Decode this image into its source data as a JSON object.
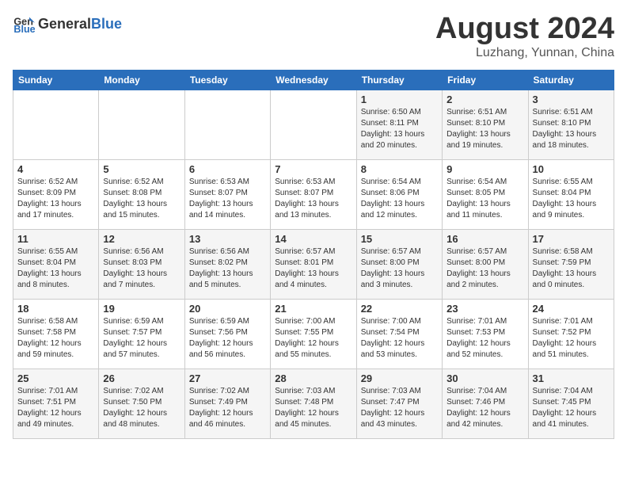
{
  "header": {
    "logo_general": "General",
    "logo_blue": "Blue",
    "month_year": "August 2024",
    "location": "Luzhang, Yunnan, China"
  },
  "weekdays": [
    "Sunday",
    "Monday",
    "Tuesday",
    "Wednesday",
    "Thursday",
    "Friday",
    "Saturday"
  ],
  "weeks": [
    [
      {
        "day": "",
        "info": ""
      },
      {
        "day": "",
        "info": ""
      },
      {
        "day": "",
        "info": ""
      },
      {
        "day": "",
        "info": ""
      },
      {
        "day": "1",
        "info": "Sunrise: 6:50 AM\nSunset: 8:11 PM\nDaylight: 13 hours\nand 20 minutes."
      },
      {
        "day": "2",
        "info": "Sunrise: 6:51 AM\nSunset: 8:10 PM\nDaylight: 13 hours\nand 19 minutes."
      },
      {
        "day": "3",
        "info": "Sunrise: 6:51 AM\nSunset: 8:10 PM\nDaylight: 13 hours\nand 18 minutes."
      }
    ],
    [
      {
        "day": "4",
        "info": "Sunrise: 6:52 AM\nSunset: 8:09 PM\nDaylight: 13 hours\nand 17 minutes."
      },
      {
        "day": "5",
        "info": "Sunrise: 6:52 AM\nSunset: 8:08 PM\nDaylight: 13 hours\nand 15 minutes."
      },
      {
        "day": "6",
        "info": "Sunrise: 6:53 AM\nSunset: 8:07 PM\nDaylight: 13 hours\nand 14 minutes."
      },
      {
        "day": "7",
        "info": "Sunrise: 6:53 AM\nSunset: 8:07 PM\nDaylight: 13 hours\nand 13 minutes."
      },
      {
        "day": "8",
        "info": "Sunrise: 6:54 AM\nSunset: 8:06 PM\nDaylight: 13 hours\nand 12 minutes."
      },
      {
        "day": "9",
        "info": "Sunrise: 6:54 AM\nSunset: 8:05 PM\nDaylight: 13 hours\nand 11 minutes."
      },
      {
        "day": "10",
        "info": "Sunrise: 6:55 AM\nSunset: 8:04 PM\nDaylight: 13 hours\nand 9 minutes."
      }
    ],
    [
      {
        "day": "11",
        "info": "Sunrise: 6:55 AM\nSunset: 8:04 PM\nDaylight: 13 hours\nand 8 minutes."
      },
      {
        "day": "12",
        "info": "Sunrise: 6:56 AM\nSunset: 8:03 PM\nDaylight: 13 hours\nand 7 minutes."
      },
      {
        "day": "13",
        "info": "Sunrise: 6:56 AM\nSunset: 8:02 PM\nDaylight: 13 hours\nand 5 minutes."
      },
      {
        "day": "14",
        "info": "Sunrise: 6:57 AM\nSunset: 8:01 PM\nDaylight: 13 hours\nand 4 minutes."
      },
      {
        "day": "15",
        "info": "Sunrise: 6:57 AM\nSunset: 8:00 PM\nDaylight: 13 hours\nand 3 minutes."
      },
      {
        "day": "16",
        "info": "Sunrise: 6:57 AM\nSunset: 8:00 PM\nDaylight: 13 hours\nand 2 minutes."
      },
      {
        "day": "17",
        "info": "Sunrise: 6:58 AM\nSunset: 7:59 PM\nDaylight: 13 hours\nand 0 minutes."
      }
    ],
    [
      {
        "day": "18",
        "info": "Sunrise: 6:58 AM\nSunset: 7:58 PM\nDaylight: 12 hours\nand 59 minutes."
      },
      {
        "day": "19",
        "info": "Sunrise: 6:59 AM\nSunset: 7:57 PM\nDaylight: 12 hours\nand 57 minutes."
      },
      {
        "day": "20",
        "info": "Sunrise: 6:59 AM\nSunset: 7:56 PM\nDaylight: 12 hours\nand 56 minutes."
      },
      {
        "day": "21",
        "info": "Sunrise: 7:00 AM\nSunset: 7:55 PM\nDaylight: 12 hours\nand 55 minutes."
      },
      {
        "day": "22",
        "info": "Sunrise: 7:00 AM\nSunset: 7:54 PM\nDaylight: 12 hours\nand 53 minutes."
      },
      {
        "day": "23",
        "info": "Sunrise: 7:01 AM\nSunset: 7:53 PM\nDaylight: 12 hours\nand 52 minutes."
      },
      {
        "day": "24",
        "info": "Sunrise: 7:01 AM\nSunset: 7:52 PM\nDaylight: 12 hours\nand 51 minutes."
      }
    ],
    [
      {
        "day": "25",
        "info": "Sunrise: 7:01 AM\nSunset: 7:51 PM\nDaylight: 12 hours\nand 49 minutes."
      },
      {
        "day": "26",
        "info": "Sunrise: 7:02 AM\nSunset: 7:50 PM\nDaylight: 12 hours\nand 48 minutes."
      },
      {
        "day": "27",
        "info": "Sunrise: 7:02 AM\nSunset: 7:49 PM\nDaylight: 12 hours\nand 46 minutes."
      },
      {
        "day": "28",
        "info": "Sunrise: 7:03 AM\nSunset: 7:48 PM\nDaylight: 12 hours\nand 45 minutes."
      },
      {
        "day": "29",
        "info": "Sunrise: 7:03 AM\nSunset: 7:47 PM\nDaylight: 12 hours\nand 43 minutes."
      },
      {
        "day": "30",
        "info": "Sunrise: 7:04 AM\nSunset: 7:46 PM\nDaylight: 12 hours\nand 42 minutes."
      },
      {
        "day": "31",
        "info": "Sunrise: 7:04 AM\nSunset: 7:45 PM\nDaylight: 12 hours\nand 41 minutes."
      }
    ]
  ]
}
